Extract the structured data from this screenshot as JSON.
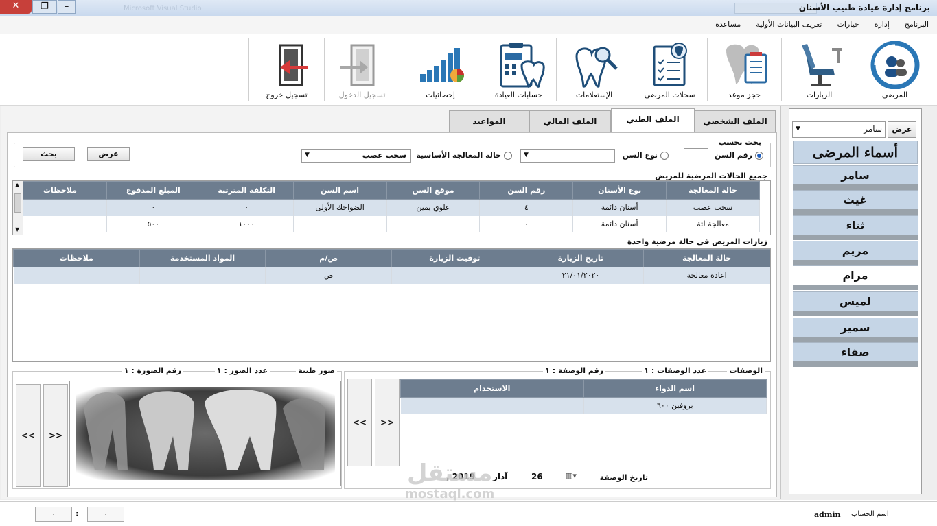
{
  "window": {
    "title": "برنامج إدارة عيادة طبيب الأسنان",
    "close_glyph": "✕",
    "max_glyph": "❐",
    "min_glyph": "–",
    "title_faint": "Microsoft Visual Studio"
  },
  "menu": [
    "البرنامج",
    "إدارة",
    "خيارات",
    "تعريف البيانات الأولية",
    "مساعدة"
  ],
  "toolbar": {
    "patients": "المرضى",
    "visits": "الزيارات",
    "appointment": "حجز موعد",
    "records": "سجلات المرضى",
    "inquiries": "الإستعلامات",
    "accounts": "حسابات العيادة",
    "stats": "إحصائيات",
    "login": "تسجيل الدخول",
    "logout": "تسجيل خروج"
  },
  "tabs": {
    "personal": "الملف الشخصي",
    "medical": "الملف الطبي",
    "financial": "الملف المالي",
    "appointments": "المواعيد"
  },
  "search": {
    "legend": "بحث بحسب",
    "tooth_number": "رقم السن",
    "tooth_type": "نوع السن",
    "treatment_status": "حالة المعالجة الأساسية",
    "status_value": "سحب عصب",
    "show": "عرض",
    "search": "بحث"
  },
  "cases": {
    "legend": "جميع الحالات المرضية للمريض",
    "headers": [
      "حالة المعالجة",
      "نوع الأسنان",
      "رقم السن",
      "موقع السن",
      "اسم السن",
      "التكلفة المترتبة",
      "المبلغ المدفوع",
      "ملاحظات"
    ],
    "rows": [
      [
        "سحب عصب",
        "أسنان دائمة",
        "٤",
        "علوي يمين",
        "الضواحك الأولى",
        "٠",
        "٠",
        ""
      ],
      [
        "معالجة لثة",
        "أسنان دائمة",
        "٠",
        "",
        "",
        "١٠٠٠",
        "٥٠٠",
        ""
      ]
    ]
  },
  "visits": {
    "legend": "زيارات المريض في حالة مرضية واحدة",
    "headers": [
      "حالة المعالجة",
      "تاريخ الزيارة",
      "توقيت الزيارة",
      "ص/م",
      "المواد المستخدمة",
      "ملاحظات"
    ],
    "rows": [
      [
        "اعادة معالجة",
        "٢١/٠١/٢٠٢٠",
        "",
        "ص",
        "",
        ""
      ]
    ]
  },
  "prescriptions": {
    "legend": "الوصفات",
    "count_label": "عدد الوصفات : ١",
    "number_label": "رقم الوصفة : ١",
    "headers": [
      "اسم الدواء",
      "الاستخدام"
    ],
    "rows": [
      [
        "بروفين ٦٠٠",
        ""
      ]
    ],
    "date_label": "تاريخ الوصفة",
    "date_day": "26",
    "date_month": "آذار",
    "date_year": ", 2019",
    "nav_next": ">>",
    "nav_prev": "<<"
  },
  "images": {
    "legend": "صور طبية",
    "count_label": "عدد الصور : ١",
    "number_label": "رقم الصورة : ١",
    "nav_next": ">>",
    "nav_prev": "<<"
  },
  "sidebar": {
    "show": "عرض",
    "selected_patient": "سامر",
    "title": "أسماء المرضى",
    "names": [
      "سامر",
      "غيث",
      "ثناء",
      "مريم",
      "مرام",
      "لميس",
      "سمير",
      "صفاء"
    ]
  },
  "status": {
    "account_label": "اسم الحساب",
    "account_value": "admin",
    "box1": "٠",
    "sep": ":",
    "box2": "٠"
  },
  "watermark": {
    "arabic": "مستقل",
    "latin": "mostaql.com"
  },
  "colors": {
    "grid_header": "#6d7d8f",
    "name_item": "#c5d5e6",
    "close_button": "#c7403a"
  }
}
